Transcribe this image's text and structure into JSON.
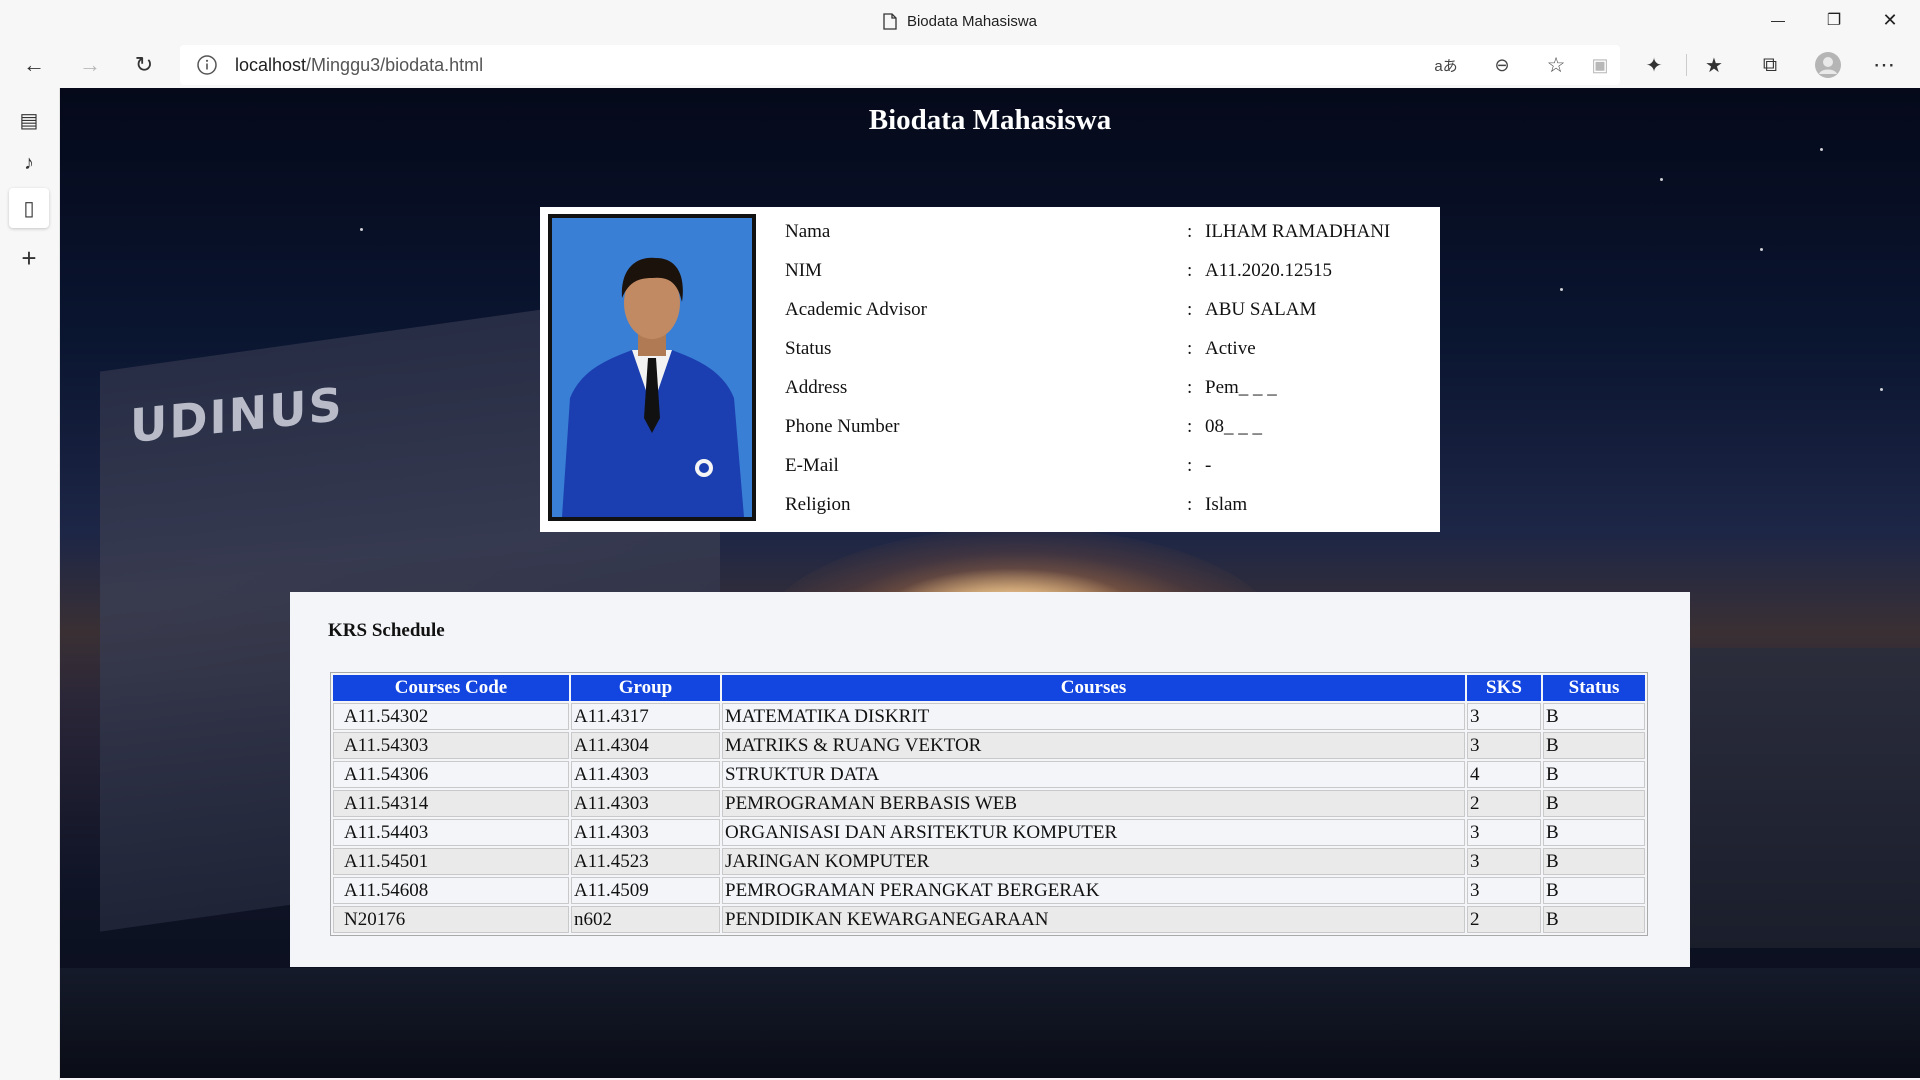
{
  "window": {
    "title": "Biodata Mahasiswa",
    "minimize_glyph": "—",
    "maximize_glyph": "❐",
    "close_glyph": "✕"
  },
  "toolbar": {
    "back_glyph": "←",
    "forward_glyph": "→",
    "reload_glyph": "↻",
    "url_host": "localhost",
    "url_path": "/Minggu3/biodata.html",
    "read_aloud_glyph": "aあ",
    "zoom_glyph": "⊖",
    "favorite_add_glyph": "☆",
    "collections_glyph": "▣",
    "extensions_glyph": "✦",
    "favorites_glyph": "★",
    "tabs_glyph": "⧉",
    "more_glyph": "⋯"
  },
  "sidebar": {
    "items": [
      {
        "name": "tab-actions-icon",
        "glyph": "▤"
      },
      {
        "name": "speaker-icon",
        "glyph": "♪"
      },
      {
        "name": "page-icon",
        "glyph": "▯"
      },
      {
        "name": "add-icon",
        "glyph": "+"
      }
    ]
  },
  "page": {
    "title": "Biodata Mahasiswa",
    "background_sign": "UDINUS"
  },
  "biodata": [
    {
      "label": "Nama",
      "colon": ":",
      "value": "ILHAM RAMADHANI"
    },
    {
      "label": "NIM",
      "colon": ":",
      "value": "A11.2020.12515"
    },
    {
      "label": "Academic Advisor",
      "colon": ":",
      "value": "ABU SALAM"
    },
    {
      "label": "Status",
      "colon": ":",
      "value": "Active"
    },
    {
      "label": "Address",
      "colon": ":",
      "value": "Pem_ _ _"
    },
    {
      "label": "Phone Number",
      "colon": ":",
      "value": "08_ _ _"
    },
    {
      "label": "E-Mail",
      "colon": ":",
      "value": "-"
    },
    {
      "label": "Religion",
      "colon": ":",
      "value": "Islam"
    }
  ],
  "krs": {
    "title": "KRS Schedule",
    "headers": [
      "Courses Code",
      "Group",
      "Courses",
      "SKS",
      "Status"
    ],
    "rows": [
      [
        "A11.54302",
        "A11.4317",
        "MATEMATIKA DISKRIT",
        "3",
        "B"
      ],
      [
        "A11.54303",
        "A11.4304",
        "MATRIKS & RUANG VEKTOR",
        "3",
        "B"
      ],
      [
        "A11.54306",
        "A11.4303",
        "STRUKTUR DATA",
        "4",
        "B"
      ],
      [
        "A11.54314",
        "A11.4303",
        "PEMROGRAMAN BERBASIS WEB",
        "2",
        "B"
      ],
      [
        "A11.54403",
        "A11.4303",
        "ORGANISASI DAN ARSITEKTUR KOMPUTER",
        "3",
        "B"
      ],
      [
        "A11.54501",
        "A11.4523",
        "JARINGAN KOMPUTER",
        "3",
        "B"
      ],
      [
        "A11.54608",
        "A11.4509",
        "PEMROGRAMAN PERANGKAT BERGERAK",
        "3",
        "B"
      ],
      [
        "N20176",
        "n602",
        "PENDIDIKAN KEWARGANEGARAAN",
        "2",
        "B"
      ]
    ]
  },
  "colors": {
    "table_header": "#1346e0",
    "photo_background": "#3a7fd6",
    "jacket": "#1b3fb0"
  }
}
